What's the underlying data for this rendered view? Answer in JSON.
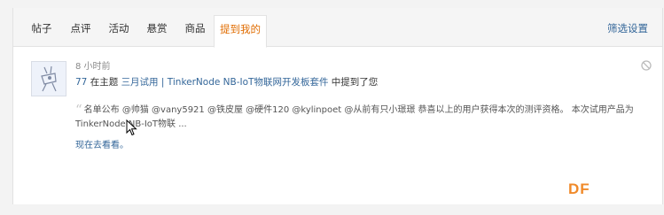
{
  "tabs": [
    {
      "label": "帖子"
    },
    {
      "label": "点评"
    },
    {
      "label": "活动"
    },
    {
      "label": "悬赏"
    },
    {
      "label": "商品"
    },
    {
      "label": "提到我的"
    }
  ],
  "active_tab": "提到我的",
  "filter_label": "筛选设置",
  "notice": {
    "time": "8 小时前",
    "user": "77",
    "text_before": " 在主题 ",
    "thread_title": "三月试用 | TinkerNode NB-IoT物联网开发板套件",
    "text_after": " 中提到了您",
    "quote": "名单公布 @帅猫 @vany5921 @铁皮屋 @硬件120 @kylinpoet @从前有只小璟璟 恭喜以上的用户获得本次的测评资格。 本次试用产品为TinkerNode NB-IoT物联 ...",
    "goto_label": "现在去看看。"
  },
  "watermark": "DF",
  "colors": {
    "link": "#336699",
    "active_tab": "#e06c00",
    "watermark": "#f08a2a"
  }
}
